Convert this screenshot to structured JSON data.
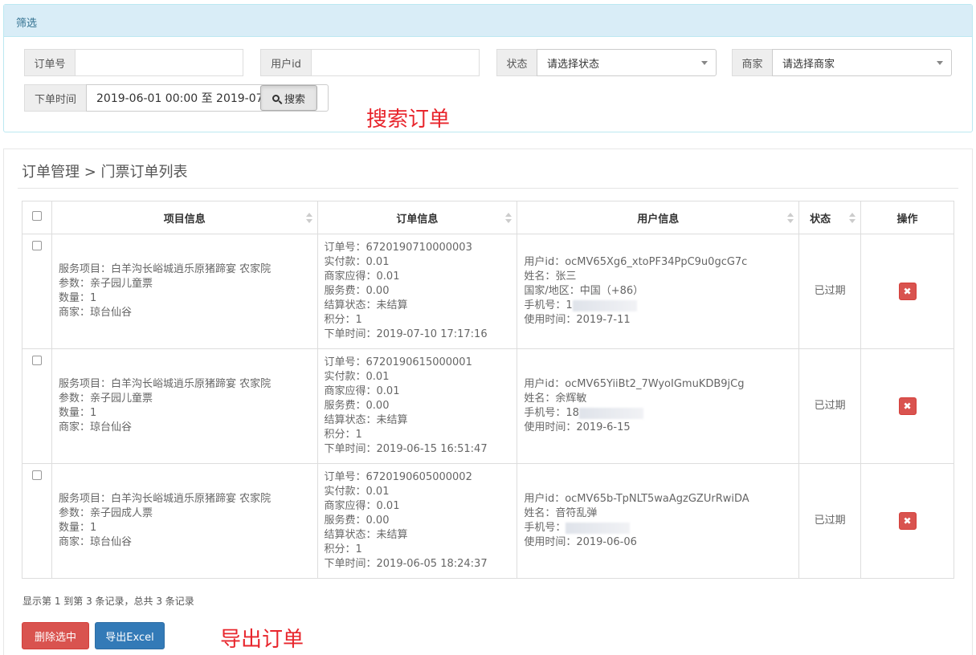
{
  "filter": {
    "heading": "筛选",
    "order_no_label": "订单号",
    "order_no_value": "",
    "user_id_label": "用户id",
    "user_id_value": "",
    "status_label": "状态",
    "status_selected": "请选择状态",
    "merchant_label": "商家",
    "merchant_selected": "请选择商家",
    "time_label": "下单时间",
    "time_value": "2019-06-01 00:00 至 2019-07-",
    "search_label": "搜索",
    "annotation": "搜索订单"
  },
  "page": {
    "breadcrumb": "订单管理 > 门票订单列表"
  },
  "table": {
    "headers": {
      "project": "项目信息",
      "order": "订单信息",
      "user": "用户信息",
      "status": "状态",
      "action": "操作"
    },
    "rows": [
      {
        "project": [
          "服务项目：白羊沟长峪城逍乐原猪蹄宴 农家院",
          "参数：亲子园儿童票",
          "数量：1",
          "商家：琼台仙谷"
        ],
        "order": [
          "订单号：6720190710000003",
          "实付款：0.01",
          "商家应得：0.01",
          "服务费：0.00",
          "结算状态：未结算",
          "积分：1",
          "下单时间：2019-07-10 17:17:16"
        ],
        "user": [
          "用户id：ocMV65Xg6_xtoPF34PpC9u0gcG7c",
          "姓名：张三",
          "国家/地区：中国（+86）",
          "手机号：1",
          "使用时间：2019-7-11"
        ],
        "status": "已过期"
      },
      {
        "project": [
          "服务项目：白羊沟长峪城逍乐原猪蹄宴 农家院",
          "参数：亲子园儿童票",
          "数量：1",
          "商家：琼台仙谷"
        ],
        "order": [
          "订单号：6720190615000001",
          "实付款：0.01",
          "商家应得：0.01",
          "服务费：0.00",
          "结算状态：未结算",
          "积分：1",
          "下单时间：2019-06-15 16:51:47"
        ],
        "user": [
          "用户id：ocMV65YiiBt2_7WyoIGmuKDB9jCg",
          "姓名：余辉敏",
          "手机号：18",
          "使用时间：2019-6-15"
        ],
        "status": "已过期"
      },
      {
        "project": [
          "服务项目：白羊沟长峪城逍乐原猪蹄宴 农家院",
          "参数：亲子园成人票",
          "数量：1",
          "商家：琼台仙谷"
        ],
        "order": [
          "订单号：6720190605000002",
          "实付款：0.01",
          "商家应得：0.01",
          "服务费：0.00",
          "结算状态：未结算",
          "积分：1",
          "下单时间：2019-06-05 18:24:37"
        ],
        "user": [
          "用户id：ocMV65b-TpNLT5waAgzGZUrRwiDA",
          "姓名：音符乱弹",
          "手机号：",
          "使用时间：2019-06-06"
        ],
        "status": "已过期"
      }
    ],
    "summary": "显示第 1 到第 3 条记录，总共 3 条记录"
  },
  "actions": {
    "delete_selected": "删除选中",
    "export_excel": "导出Excel",
    "annotation": "导出订单"
  },
  "colors": {
    "danger": "#d9534f",
    "primary": "#337ab7",
    "annotation": "#e8252c",
    "filter_header": "#d9edf7"
  }
}
